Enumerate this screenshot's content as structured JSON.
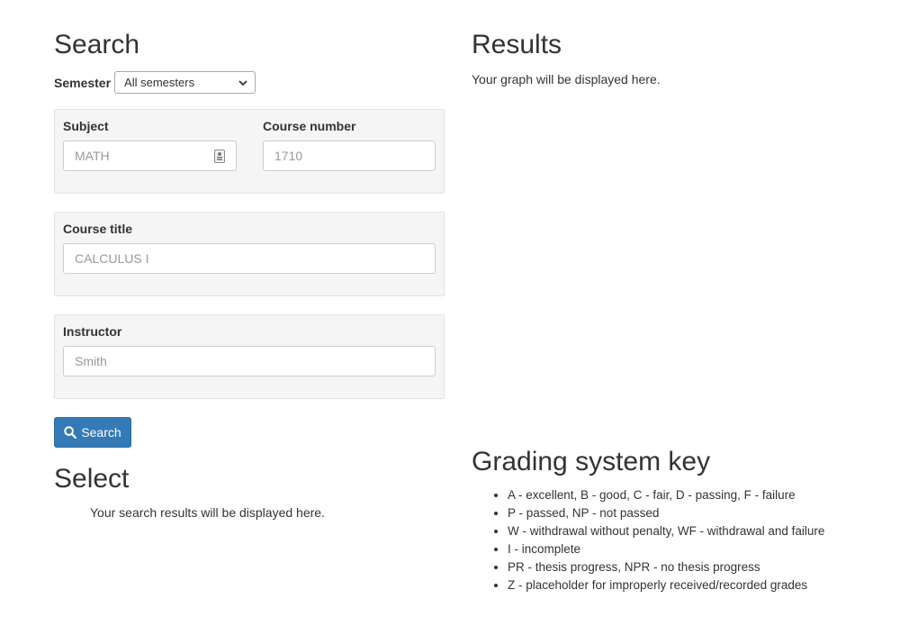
{
  "search": {
    "heading": "Search",
    "semester": {
      "label": "Semester",
      "selected": "All semesters"
    },
    "subject": {
      "label": "Subject",
      "placeholder": "MATH"
    },
    "course_number": {
      "label": "Course number",
      "placeholder": "1710"
    },
    "course_title": {
      "label": "Course title",
      "placeholder": "CALCULUS I"
    },
    "instructor": {
      "label": "Instructor",
      "placeholder": "Smith"
    },
    "search_button": "Search"
  },
  "select": {
    "heading": "Select",
    "message": "Your search results will be displayed here."
  },
  "results": {
    "heading": "Results",
    "message": "Your graph will be displayed here."
  },
  "grading_key": {
    "heading": "Grading system key",
    "items": [
      "A - excellent, B - good, C - fair, D - passing, F - failure",
      "P - passed, NP - not passed",
      "W - withdrawal without penalty, WF - withdrawal and failure",
      "I - incomplete",
      "PR - thesis progress, NPR - no thesis progress",
      "Z - placeholder for improperly received/recorded grades"
    ]
  }
}
